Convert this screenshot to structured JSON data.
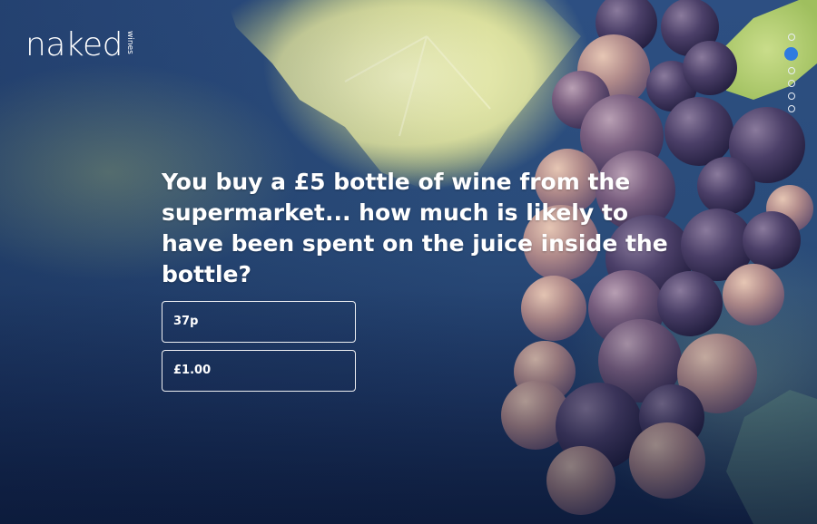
{
  "brand": {
    "name": "naked",
    "sub": "wines"
  },
  "quiz": {
    "question": "You buy a £5 bottle of wine from the supermarket... how much is likely to have been spent on the juice inside the bottle?",
    "answers": [
      {
        "label": "37p"
      },
      {
        "label": "£1.00"
      }
    ]
  },
  "pager": {
    "total": 6,
    "active_index": 1
  },
  "colors": {
    "accent": "#2f7be0",
    "text": "#ffffff",
    "background": "#2a4c7a"
  }
}
